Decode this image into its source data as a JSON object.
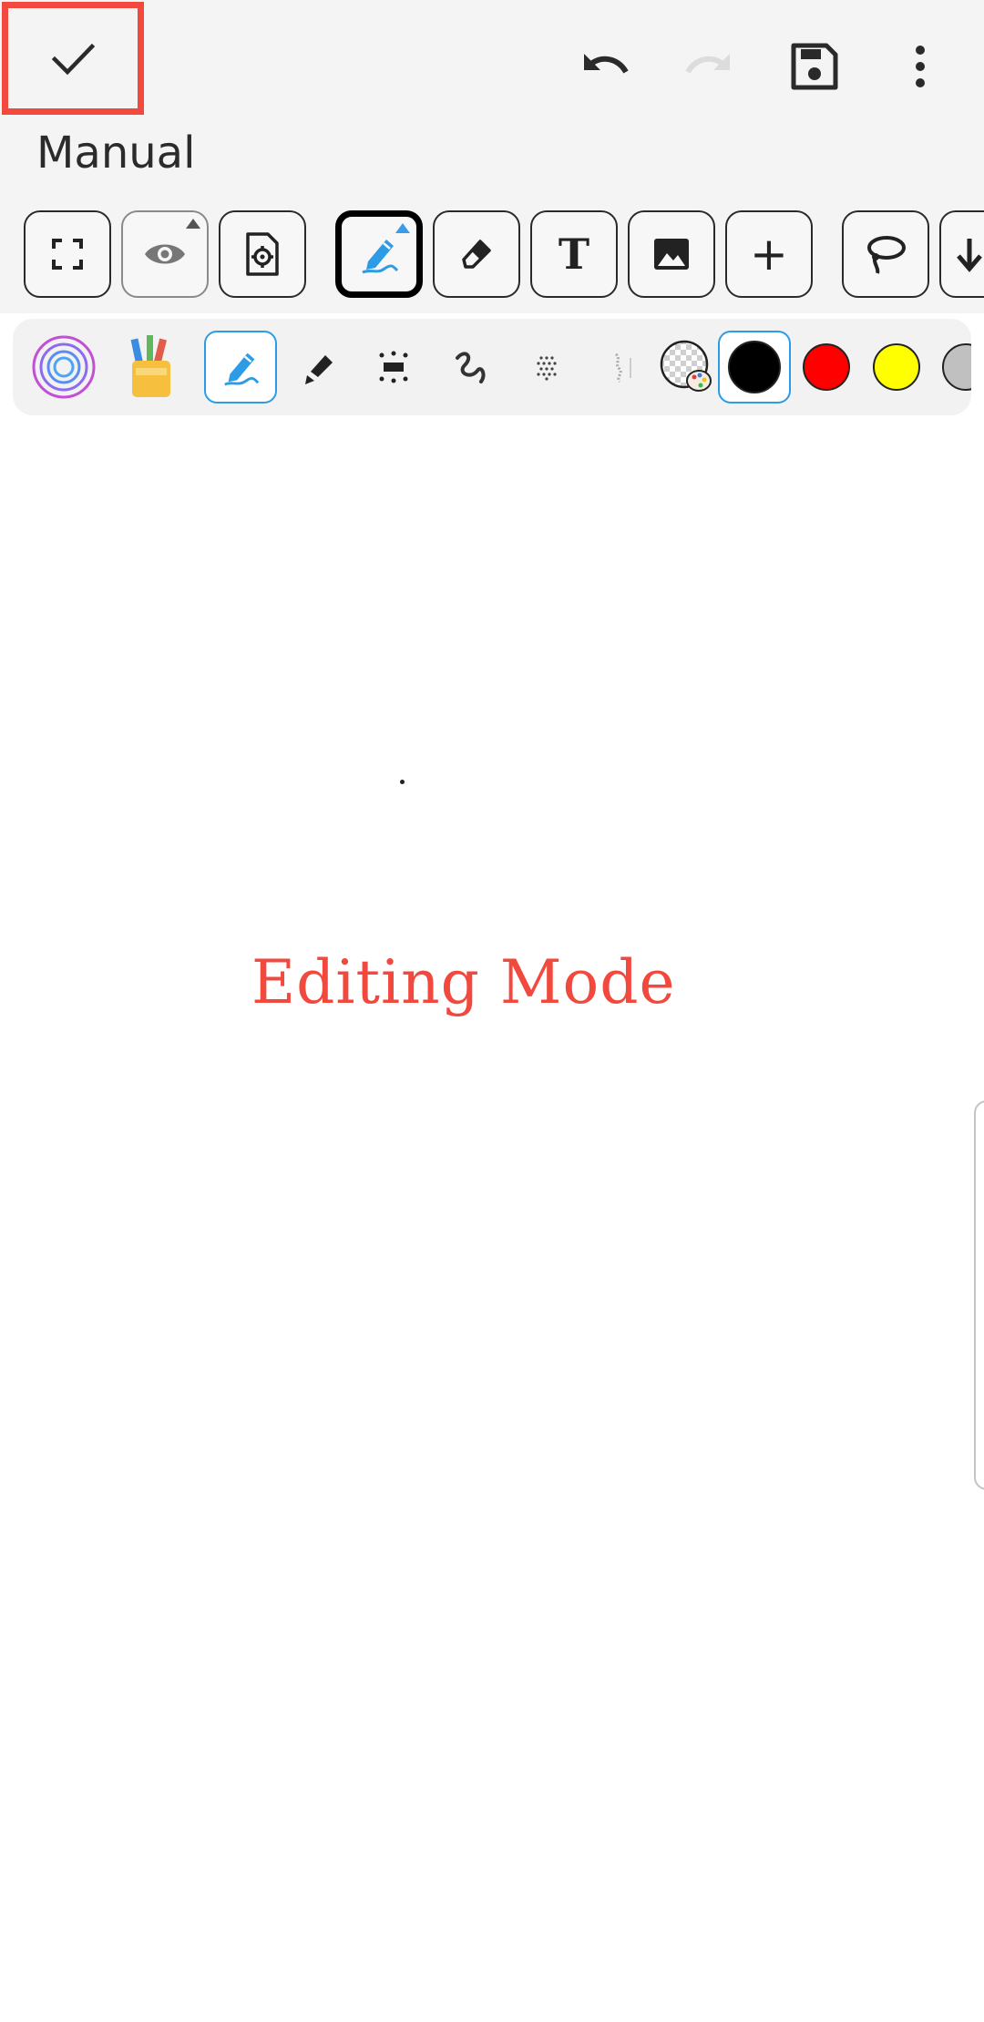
{
  "header": {
    "title": "Manual",
    "done_icon": "check-icon",
    "undo_icon": "undo-icon",
    "redo_icon": "redo-icon",
    "save_icon": "save-icon",
    "more_icon": "more-vert-icon"
  },
  "toolbar": {
    "tools": [
      {
        "name": "fullscreen",
        "icon": "fullscreen-icon"
      },
      {
        "name": "view",
        "icon": "eye-icon",
        "has_menu": true
      },
      {
        "name": "page-settings",
        "icon": "file-settings-icon"
      },
      {
        "name": "pen",
        "icon": "pen-icon",
        "active": true,
        "has_menu": true
      },
      {
        "name": "eraser",
        "icon": "eraser-icon"
      },
      {
        "name": "text",
        "icon": "text-icon",
        "label": "T"
      },
      {
        "name": "image",
        "icon": "image-icon"
      },
      {
        "name": "add",
        "icon": "plus-icon",
        "label": "+"
      },
      {
        "name": "lasso",
        "icon": "lasso-icon"
      },
      {
        "name": "more",
        "icon": "arrow-down-icon"
      }
    ]
  },
  "pen_options": {
    "items": [
      {
        "name": "thickness",
        "icon": "thickness-rings-icon"
      },
      {
        "name": "pen-case",
        "icon": "pencil-cup-icon"
      },
      {
        "name": "fountain-pen",
        "icon": "pen-icon",
        "selected": true
      },
      {
        "name": "marker",
        "icon": "marker-icon"
      },
      {
        "name": "dotted-pen",
        "icon": "dotted-line-icon"
      },
      {
        "name": "brush-pen",
        "icon": "squiggle-icon"
      },
      {
        "name": "airbrush",
        "icon": "spray-icon"
      },
      {
        "name": "texture-pen",
        "icon": "texture-icon"
      }
    ],
    "colors": [
      {
        "name": "custom",
        "hex": "palette"
      },
      {
        "name": "black",
        "hex": "#000000",
        "selected": true
      },
      {
        "name": "red",
        "hex": "#ff0000"
      },
      {
        "name": "yellow",
        "hex": "#ffff00"
      },
      {
        "name": "grey",
        "hex": "#c0c0c0"
      }
    ]
  },
  "canvas": {
    "mode_label": "Editing Mode",
    "mode_color": "#f2493e"
  }
}
